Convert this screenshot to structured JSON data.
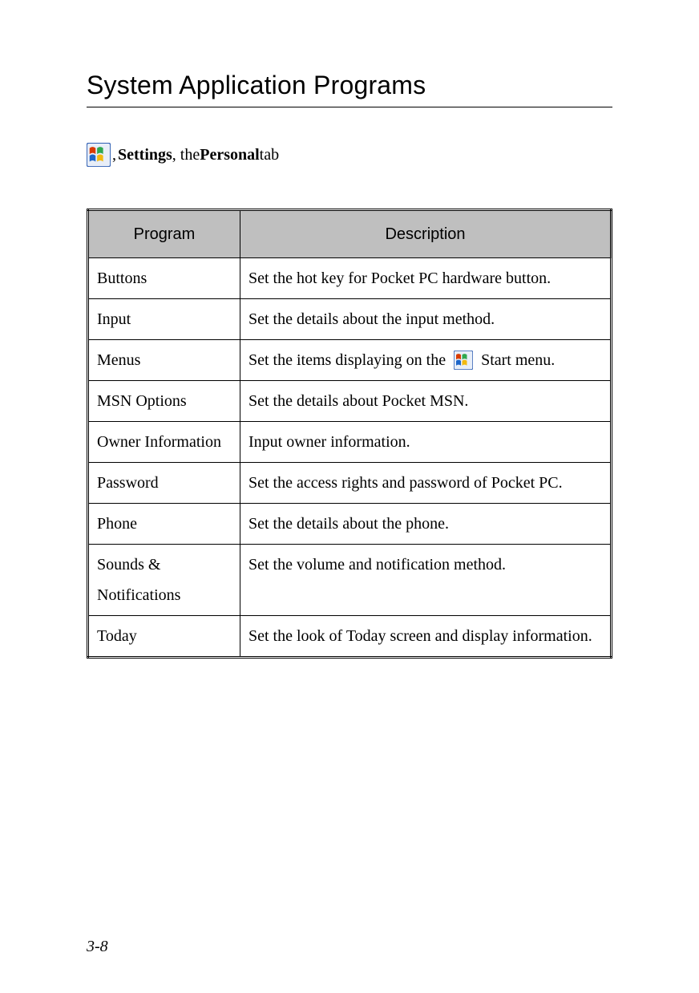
{
  "title": "System Application Programs",
  "breadcrumb": {
    "settings": "Settings",
    "sep1": ", ",
    "sep2": ", the ",
    "personal": "Personal",
    "tab_suffix": " tab"
  },
  "icons": {
    "windows_start": "windows-start-icon"
  },
  "table": {
    "headers": {
      "program": "Program",
      "description": "Description"
    },
    "rows": [
      {
        "program": "Buttons",
        "description": "Set the hot key for Pocket PC hardware button."
      },
      {
        "program": "Input",
        "description": "Set the details about the input method."
      },
      {
        "program": "Menus",
        "description_pre": "Set the items displaying on the ",
        "has_icon": true,
        "description_post": " Start menu."
      },
      {
        "program": "MSN Options",
        "description": "Set the details about Pocket MSN."
      },
      {
        "program": "Owner Information",
        "description": "Input owner information."
      },
      {
        "program": "Password",
        "description": "Set the access rights and password of Pocket PC."
      },
      {
        "program": "Phone",
        "description": "Set the details about the phone."
      },
      {
        "program": "Sounds & Notifications",
        "description": "Set the volume and notification method."
      },
      {
        "program": "Today",
        "description": "Set the look of Today screen and display information."
      }
    ]
  },
  "page_number": "3-8"
}
